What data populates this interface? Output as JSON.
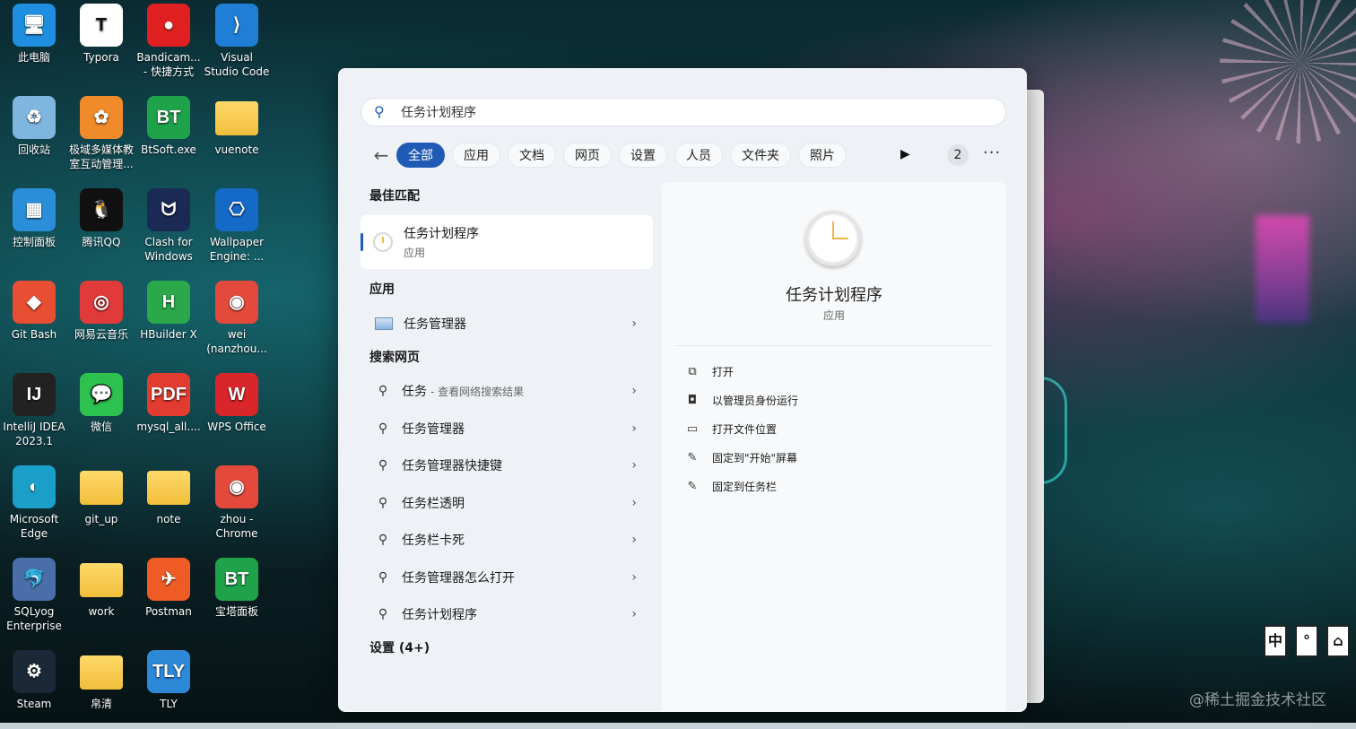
{
  "desktop": {
    "icons": [
      {
        "label": "此电脑",
        "glyph": "🖥",
        "color": "#1e8fe0"
      },
      {
        "label": "Typora",
        "glyph": "T",
        "color": "#ffffff"
      },
      {
        "label": "Bandicam... - 快捷方式",
        "glyph": "●",
        "color": "#e02020"
      },
      {
        "label": "Visual Studio Code",
        "glyph": "⟩",
        "color": "#1f7fd6"
      },
      {
        "label": "回收站",
        "glyph": "♻",
        "color": "#7fb6df"
      },
      {
        "label": "极域多媒体教室互动管理...",
        "glyph": "✿",
        "color": "#f08a2a"
      },
      {
        "label": "BtSoft.exe",
        "glyph": "BT",
        "color": "#1fa34a"
      },
      {
        "label": "vuenote",
        "glyph": "",
        "color": "#f1be3b"
      },
      {
        "label": "控制面板",
        "glyph": "▦",
        "color": "#2a8fd8"
      },
      {
        "label": "腾讯QQ",
        "glyph": "🐧",
        "color": "#111111"
      },
      {
        "label": "Clash for Windows",
        "glyph": "ᗢ",
        "color": "#1b2a55"
      },
      {
        "label": "Wallpaper Engine: ...",
        "glyph": "⎔",
        "color": "#1569c7"
      },
      {
        "label": "Git Bash",
        "glyph": "◆",
        "color": "#e84e31"
      },
      {
        "label": "网易云音乐",
        "glyph": "◎",
        "color": "#e03a3a"
      },
      {
        "label": "HBuilder X",
        "glyph": "H",
        "color": "#2aa84a"
      },
      {
        "label": "wei (nanzhou...",
        "glyph": "◉",
        "color": "#e34a3b"
      },
      {
        "label": "IntelliJ IDEA 2023.1",
        "glyph": "IJ",
        "color": "#222222"
      },
      {
        "label": "微信",
        "glyph": "💬",
        "color": "#2dc24f"
      },
      {
        "label": "mysql_all....",
        "glyph": "PDF",
        "color": "#e23b30"
      },
      {
        "label": "WPS Office",
        "glyph": "W",
        "color": "#d8262b"
      },
      {
        "label": "Microsoft Edge",
        "glyph": "◐",
        "color": "#1aa0c8"
      },
      {
        "label": "git_up",
        "glyph": "",
        "color": "#f1be3b"
      },
      {
        "label": "note",
        "glyph": "",
        "color": "#f1be3b"
      },
      {
        "label": "zhou - Chrome",
        "glyph": "◉",
        "color": "#e34a3b"
      },
      {
        "label": "SQLyog Enterprise",
        "glyph": "🐬",
        "color": "#4a6fa8"
      },
      {
        "label": "work",
        "glyph": "",
        "color": "#f1be3b"
      },
      {
        "label": "Postman",
        "glyph": "✈",
        "color": "#ef5b25"
      },
      {
        "label": "宝塔面板",
        "glyph": "BT",
        "color": "#1fa34a"
      },
      {
        "label": "Steam",
        "glyph": "⚙",
        "color": "#1b2838"
      },
      {
        "label": "帛清",
        "glyph": "",
        "color": "#f1be3b"
      },
      {
        "label": "TLY",
        "glyph": "TLY",
        "color": "#2d88d8"
      }
    ]
  },
  "search": {
    "query": "任务计划程序",
    "back_glyph": "←",
    "search_glyph": "⚲",
    "filters": [
      "全部",
      "应用",
      "文档",
      "网页",
      "设置",
      "人员",
      "文件夹",
      "照片"
    ],
    "play_glyph": "▶",
    "count": "2",
    "more_glyph": "···"
  },
  "results": {
    "best_match_header": "最佳匹配",
    "best_match": {
      "title": "任务计划程序",
      "subtitle": "应用"
    },
    "apps_header": "应用",
    "apps": [
      {
        "label": "任务管理器"
      }
    ],
    "web_header": "搜索网页",
    "web": [
      {
        "label": "任务",
        "hint": "- 查看网络搜索结果"
      },
      {
        "label": "任务管理器",
        "hint": ""
      },
      {
        "label": "任务管理器快捷键",
        "hint": ""
      },
      {
        "label": "任务栏透明",
        "hint": ""
      },
      {
        "label": "任务栏卡死",
        "hint": ""
      },
      {
        "label": "任务管理器怎么打开",
        "hint": ""
      },
      {
        "label": "任务计划程序",
        "hint": ""
      }
    ],
    "settings_header": "设置 (4+)",
    "chevron": "›"
  },
  "detail": {
    "title": "任务计划程序",
    "subtitle": "应用",
    "actions": [
      {
        "label": "打开",
        "glyph": "⧉",
        "icon": "open-icon"
      },
      {
        "label": "以管理员身份运行",
        "glyph": "◘",
        "icon": "shield-icon"
      },
      {
        "label": "打开文件位置",
        "glyph": "▭",
        "icon": "folder-icon"
      },
      {
        "label": "固定到\"开始\"屏幕",
        "glyph": "✎",
        "icon": "pin-icon"
      },
      {
        "label": "固定到任务栏",
        "glyph": "✎",
        "icon": "pin-icon"
      }
    ]
  },
  "ime": [
    "中",
    "°",
    "⌂"
  ],
  "watermark": "@稀土掘金技术社区"
}
